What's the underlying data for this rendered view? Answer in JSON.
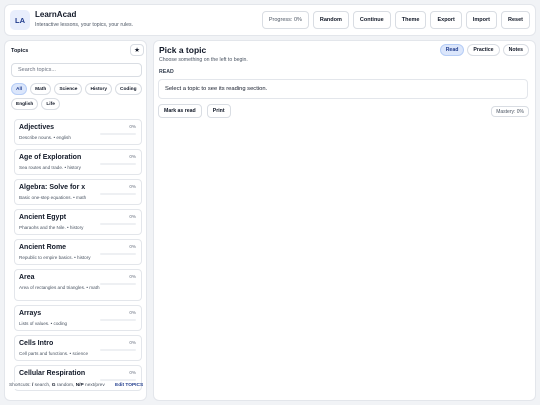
{
  "header": {
    "logo": "LA",
    "title": "LearnAcad",
    "subtitle": "Interactive lessons, your topics, your rules.",
    "progress": "Progress: 0%",
    "buttons": [
      "Random",
      "Continue",
      "Theme",
      "Export",
      "Import",
      "Reset"
    ]
  },
  "sidebar": {
    "title": "Topics",
    "favorites_icon": "star-icon",
    "search_placeholder": "Search topics...",
    "filters": [
      {
        "label": "All",
        "active": true
      },
      {
        "label": "Math",
        "active": false
      },
      {
        "label": "Science",
        "active": false
      },
      {
        "label": "History",
        "active": false
      },
      {
        "label": "Coding",
        "active": false
      },
      {
        "label": "English",
        "active": false
      },
      {
        "label": "Life",
        "active": false
      }
    ],
    "topics": [
      {
        "title": "Adjectives",
        "desc": "Describe nouns. • english",
        "pct": "0%"
      },
      {
        "title": "Age of Exploration",
        "desc": "Sea routes and trade. • history",
        "pct": "0%"
      },
      {
        "title": "Algebra: Solve for x",
        "desc": "Basic one-step equations. • math",
        "pct": "0%"
      },
      {
        "title": "Ancient Egypt",
        "desc": "Pharaohs and the Nile. • history",
        "pct": "0%"
      },
      {
        "title": "Ancient Rome",
        "desc": "Republic to empire basics. • history",
        "pct": "0%"
      },
      {
        "title": "Area",
        "desc": "Area of rectangles and triangles. • math",
        "pct": "0%"
      },
      {
        "title": "Arrays",
        "desc": "Lists of values. • coding",
        "pct": "0%"
      },
      {
        "title": "Cells Intro",
        "desc": "Cell parts and functions. • science",
        "pct": "0%"
      },
      {
        "title": "Cellular Respiration",
        "desc": "",
        "pct": "0%"
      }
    ],
    "shortcuts_prefix": "Shortcuts: ",
    "shortcut_search_key": "/",
    "shortcut_search": " search, ",
    "shortcut_random_key": "G",
    "shortcut_random": " random, ",
    "shortcut_nav_key": "N/P",
    "shortcut_nav": " next/prev",
    "edit_topics": "Edit TOPICS"
  },
  "main": {
    "title": "Pick a topic",
    "subtitle": "Choose something on the left to begin.",
    "tabs": [
      {
        "label": "Read",
        "active": true
      },
      {
        "label": "Practice",
        "active": false
      },
      {
        "label": "Notes",
        "active": false
      }
    ],
    "section_label": "READ",
    "content_text": "Select a topic to see its reading section.",
    "mark_as_read": "Mark as read",
    "print": "Print",
    "mastery": "Mastery: 0%"
  }
}
